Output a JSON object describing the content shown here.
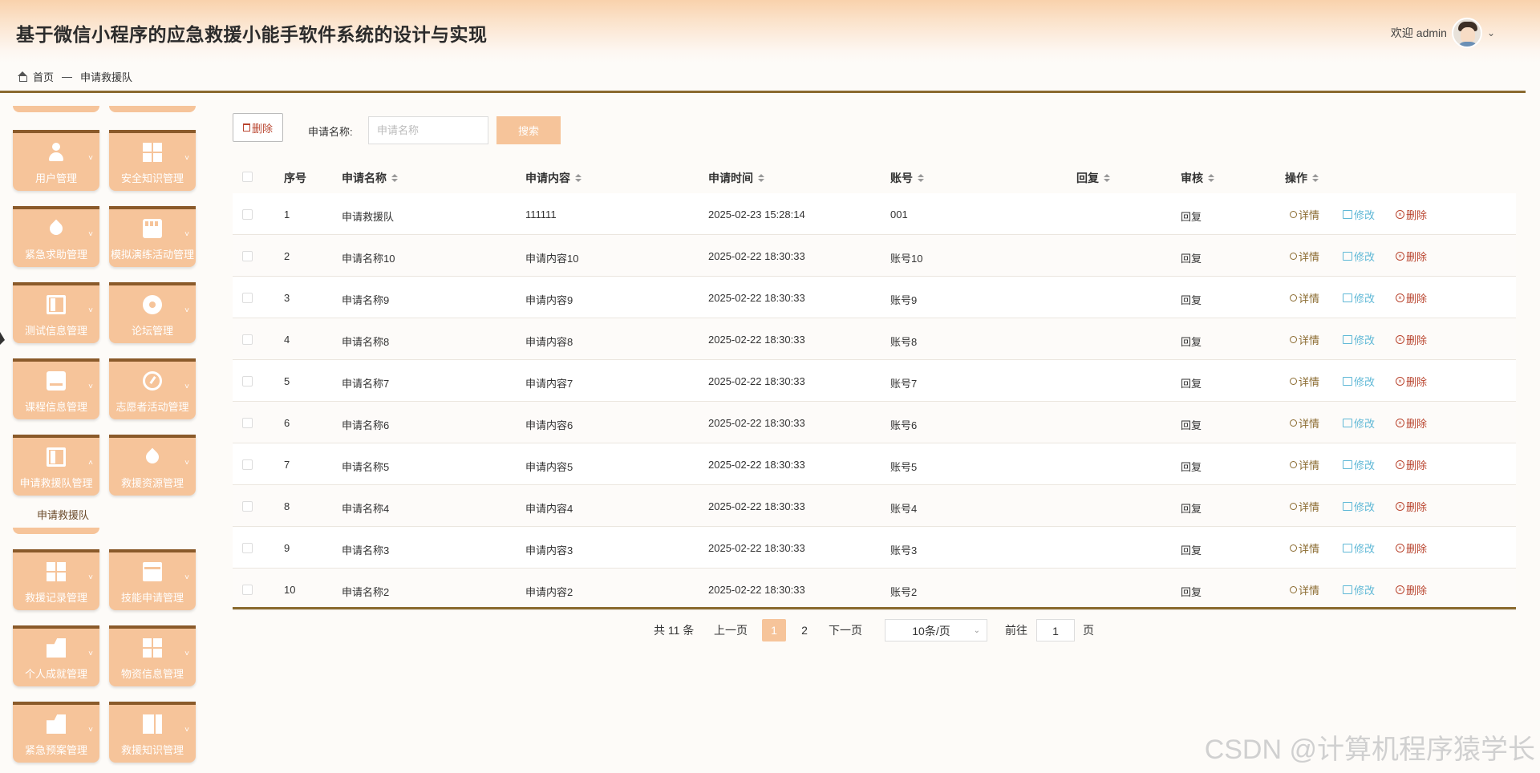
{
  "header": {
    "title": "基于微信小程序的应急救援小能手软件系统的设计与实现",
    "welcome": "欢迎 admin",
    "avatar_icon": "user-avatar",
    "dropdown_icon": "chevron-down-icon"
  },
  "breadcrumb": {
    "home": "首页",
    "separator": "—",
    "current": "申请救援队"
  },
  "sidebar": {
    "tiles": [
      {
        "label": "用户管理",
        "icon": "person-icon"
      },
      {
        "label": "安全知识管理",
        "icon": "grid-icon"
      },
      {
        "label": "紧急求助管理",
        "icon": "drop-icon"
      },
      {
        "label": "模拟演练活动管理",
        "icon": "store-icon"
      },
      {
        "label": "测试信息管理",
        "icon": "book-icon"
      },
      {
        "label": "论坛管理",
        "icon": "circle-icon"
      },
      {
        "label": "课程信息管理",
        "icon": "hdd-icon"
      },
      {
        "label": "志愿者活动管理",
        "icon": "gauge-icon"
      },
      {
        "label": "申请救援队管理",
        "icon": "book-icon"
      },
      {
        "label": "救援资源管理",
        "icon": "drop-icon"
      },
      {
        "label": "救援记录管理",
        "icon": "grid-icon"
      },
      {
        "label": "技能申请管理",
        "icon": "tray-icon"
      },
      {
        "label": "个人成就管理",
        "icon": "folder-icon"
      },
      {
        "label": "物资信息管理",
        "icon": "grid-icon"
      },
      {
        "label": "紧急预案管理",
        "icon": "folder-icon"
      },
      {
        "label": "救援知识管理",
        "icon": "split-icon"
      }
    ],
    "sub_item": "申请救援队"
  },
  "toolbar": {
    "delete_label": "删除",
    "search_label": "申请名称:",
    "search_placeholder": "申请名称",
    "search_button": "搜索"
  },
  "table": {
    "columns": [
      "序号",
      "申请名称",
      "申请内容",
      "申请时间",
      "账号",
      "回复",
      "审核",
      "操作"
    ],
    "rows": [
      [
        "1",
        "申请救援队",
        "111111",
        "2025-02-23 15:28:14",
        "001",
        "",
        "回复"
      ],
      [
        "2",
        "申请名称10",
        "申请内容10",
        "2025-02-22 18:30:33",
        "账号10",
        "",
        "回复"
      ],
      [
        "3",
        "申请名称9",
        "申请内容9",
        "2025-02-22 18:30:33",
        "账号9",
        "",
        "回复"
      ],
      [
        "4",
        "申请名称8",
        "申请内容8",
        "2025-02-22 18:30:33",
        "账号8",
        "",
        "回复"
      ],
      [
        "5",
        "申请名称7",
        "申请内容7",
        "2025-02-22 18:30:33",
        "账号7",
        "",
        "回复"
      ],
      [
        "6",
        "申请名称6",
        "申请内容6",
        "2025-02-22 18:30:33",
        "账号6",
        "",
        "回复"
      ],
      [
        "7",
        "申请名称5",
        "申请内容5",
        "2025-02-22 18:30:33",
        "账号5",
        "",
        "回复"
      ],
      [
        "8",
        "申请名称4",
        "申请内容4",
        "2025-02-22 18:30:33",
        "账号4",
        "",
        "回复"
      ],
      [
        "9",
        "申请名称3",
        "申请内容3",
        "2025-02-22 18:30:33",
        "账号3",
        "",
        "回复"
      ],
      [
        "10",
        "申请名称2",
        "申请内容2",
        "2025-02-22 18:30:33",
        "账号2",
        "",
        "回复"
      ]
    ],
    "actions": {
      "detail": "详情",
      "edit": "修改",
      "delete": "删除"
    }
  },
  "pagination": {
    "total": "共 11 条",
    "prev": "上一页",
    "pages": [
      "1",
      "2"
    ],
    "current": "1",
    "next": "下一页",
    "page_size": "10条/页",
    "goto_label": "前往",
    "goto_value": "1",
    "page_suffix": "页"
  },
  "watermark": "CSDN @计算机程序猿学长",
  "colors": {
    "accent": "#f6c49a",
    "rule": "#8a6a2f",
    "delete": "#b9452f",
    "edit": "#5fb8d6"
  }
}
